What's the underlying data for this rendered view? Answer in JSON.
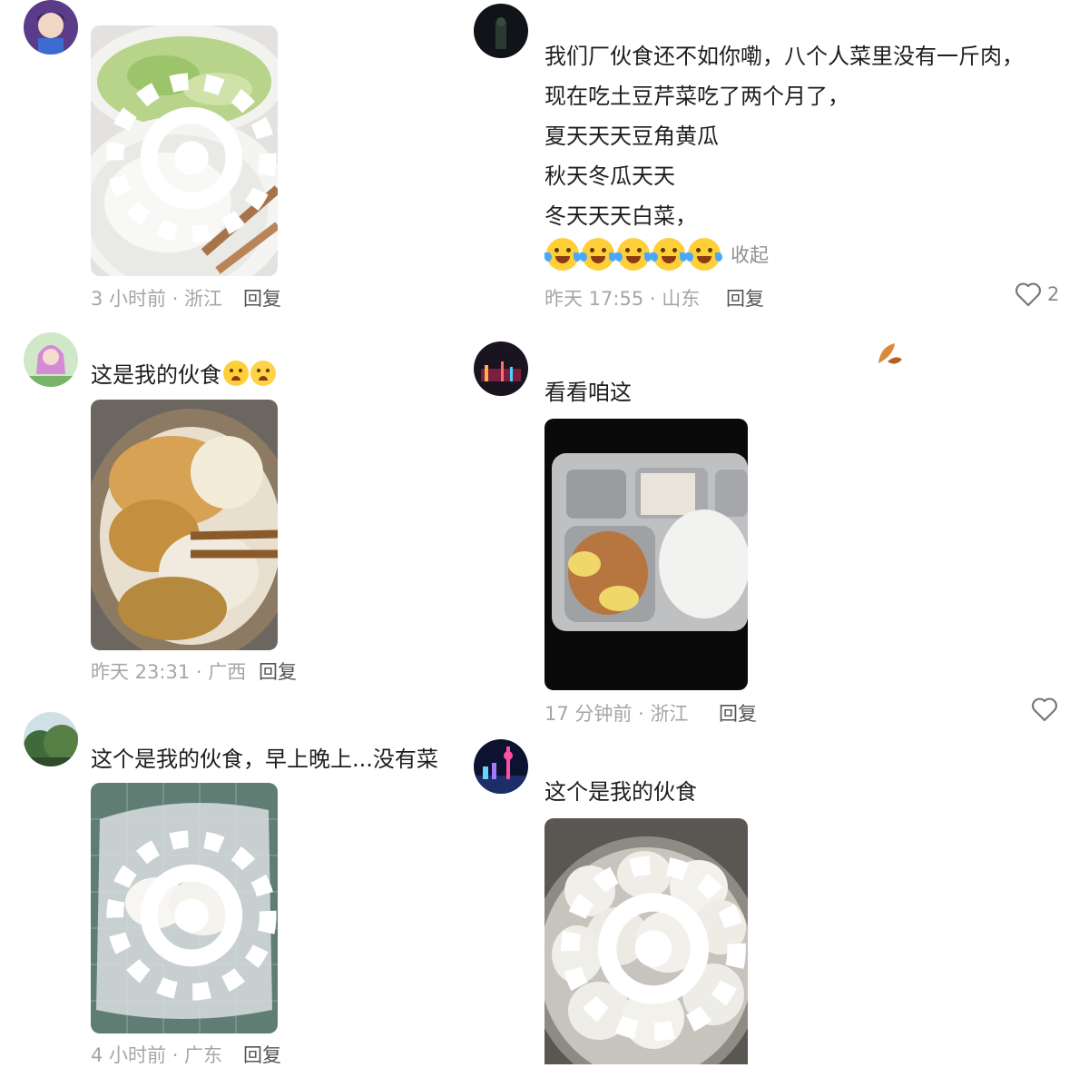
{
  "comments": [
    {
      "id": "c1",
      "text_lines": [],
      "meta": "3 小时前 · 浙江",
      "reply_label": "回复"
    },
    {
      "id": "c2",
      "text_lines": [
        "我们厂伙食还不如你嘞，八个人菜里没有一斤肉，",
        "现在吃土豆芹菜吃了两个月了，",
        "夏天天天豆角黄瓜",
        "秋天冬瓜天天",
        "冬天天天白菜，"
      ],
      "emoji_count": 5,
      "collapse_label": "收起",
      "meta": "昨天 17:55 · 山东",
      "reply_label": "回复",
      "like_count": "2"
    },
    {
      "id": "c3",
      "text": "这是我的伙食",
      "meta": "昨天 23:31 · 广西",
      "reply_label": "回复"
    },
    {
      "id": "c4",
      "text": "看看咱这",
      "meta": "17 分钟前 · 浙江",
      "reply_label": "回复"
    },
    {
      "id": "c5",
      "text": "这个是我的伙食，早上晚上...没有菜",
      "meta": "4 小时前 · 广东",
      "reply_label": "回复"
    },
    {
      "id": "c6",
      "text": "这个是我的伙食"
    }
  ],
  "icons": {
    "like": "heart-outline-icon",
    "live_photo": "live-photo-icon",
    "emoji_laugh_cry": "laughing-crying-emoji",
    "emoji_sad": "crying-emoji"
  },
  "colors": {
    "meta_text": "#a6a6a6",
    "body_text": "#1e1e1e",
    "background": "#ffffff"
  }
}
